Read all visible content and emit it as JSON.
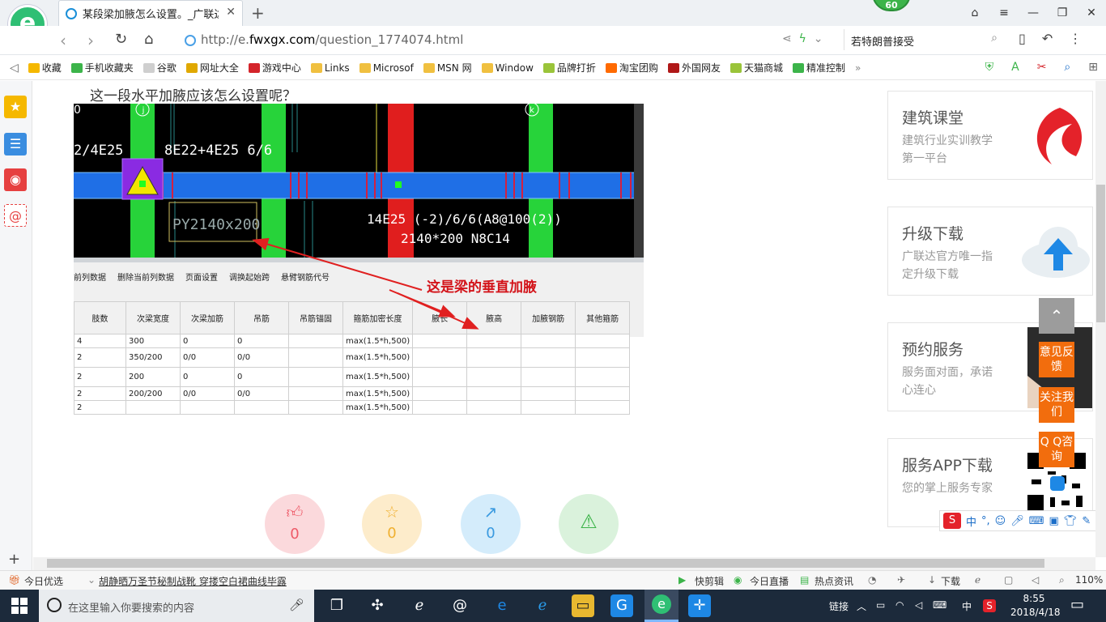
{
  "browser": {
    "tab_title": "某段梁加腋怎么设置。_广联达服",
    "badge": "60",
    "url_prefix": "http://e.",
    "url_domain": "fwxgx.com",
    "url_path": "/question_1774074.html",
    "search_text": "若特朗普接受",
    "bookmarks": [
      {
        "label": "收藏",
        "color": "#f5b800"
      },
      {
        "label": "手机收藏夹",
        "color": "#3cb44a"
      },
      {
        "label": "谷歌",
        "color": "#cfcfcf"
      },
      {
        "label": "网址大全",
        "color": "#e0a800"
      },
      {
        "label": "游戏中心",
        "color": "#d4242b"
      },
      {
        "label": "Links",
        "color": "#f0c040"
      },
      {
        "label": "Microsof",
        "color": "#f0c040"
      },
      {
        "label": "MSN 网",
        "color": "#f0c040"
      },
      {
        "label": "Window",
        "color": "#f0c040"
      },
      {
        "label": "品牌打折",
        "color": "#9ac43a"
      },
      {
        "label": "淘宝团购",
        "color": "#ff6a00"
      },
      {
        "label": "外国网友",
        "color": "#b01818"
      },
      {
        "label": "天猫商城",
        "color": "#9ac43a"
      },
      {
        "label": "精准控制",
        "color": "#3cb44a"
      }
    ]
  },
  "question": {
    "title": "这一段水平加腋应该怎么设置呢？",
    "annotation": "这是梁的垂直加腋"
  },
  "cad": {
    "labels": {
      "l1": "2/4E25",
      "l2": "8E22+4E25 6/6",
      "l3": "PY2140x200",
      "l4": "14E25 (-2)/6/6(A8@100(2))",
      "l5": "2140*200 N8C14",
      "axis_j": "j",
      "axis_k": "k",
      "axis_0": "0"
    },
    "menu": [
      "前列数据",
      "删除当前列数据",
      "页面设置",
      "调换起始跨",
      "悬臂钢筋代号"
    ],
    "table": {
      "headers": [
        "肢数",
        "次梁宽度",
        "次梁加筋",
        "吊筋",
        "吊筋锚固",
        "箍筋加密长度",
        "腋长",
        "腋高",
        "加腋钢筋",
        "其他箍筋"
      ],
      "rows": [
        [
          "4",
          "300",
          "0",
          "0",
          "",
          "max(1.5*h,500)",
          "",
          "",
          "",
          ""
        ],
        [
          "2",
          "350/200",
          "0/0",
          "0/0",
          "",
          "max(1.5*h,500)",
          "",
          "",
          "",
          ""
        ],
        [
          "2",
          "200",
          "0",
          "0",
          "",
          "max(1.5*h,500)",
          "",
          "",
          "",
          ""
        ],
        [
          "2",
          "200/200",
          "0/0",
          "0/0",
          "",
          "max(1.5*h,500)",
          "",
          "",
          "",
          ""
        ],
        [
          "2",
          "",
          "",
          "",
          "",
          "max(1.5*h,500)",
          "",
          "",
          "",
          ""
        ]
      ]
    }
  },
  "reactions": {
    "like": "0",
    "favorite": "0",
    "share": "0"
  },
  "cards": [
    {
      "title": "建筑课堂",
      "subtitle": "建筑行业实训教学第一平台"
    },
    {
      "title": "升级下载",
      "subtitle": "广联达官方唯一指定升级下载"
    },
    {
      "title": "预约服务",
      "subtitle": "服务面对面，承诺心连心"
    },
    {
      "title": "服务APP下载",
      "subtitle": "您的掌上服务专家"
    }
  ],
  "float_buttons": {
    "feedback": "意见反馈",
    "follow": "关注我们",
    "qq": "Q Q咨询"
  },
  "ime": {
    "label": "中"
  },
  "statusbar": {
    "today": "今日优选",
    "news": "胡静晒万圣节秘制战靴 穿搂空白裙曲线毕露",
    "kuaijianji": "快剪辑",
    "live": "今日直播",
    "hot": "热点资讯",
    "download": "下载",
    "zoom": "110%"
  },
  "taskbar": {
    "search_placeholder": "在这里输入你要搜索的内容",
    "link": "链接",
    "lang": "中",
    "time": "8:55",
    "date": "2018/4/18"
  }
}
